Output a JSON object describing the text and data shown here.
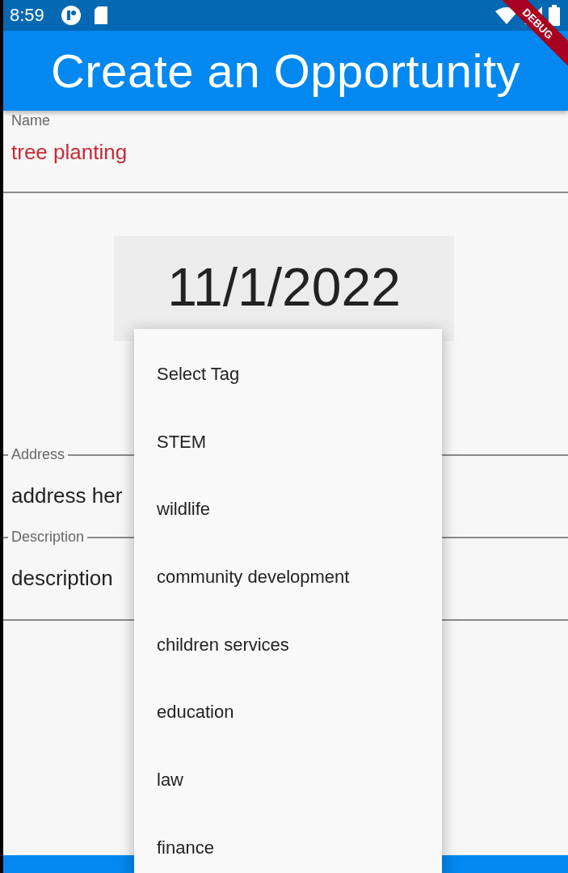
{
  "status_bar": {
    "time": "8:59"
  },
  "debug_banner": "DEBUG",
  "app_bar": {
    "title": "Create an Opportunity"
  },
  "name_field": {
    "label": "Name",
    "value": "tree planting"
  },
  "date_button": {
    "label": "11/1/2022"
  },
  "address_field": {
    "label": "Address",
    "value": "address her"
  },
  "description_field": {
    "label": "Description",
    "value": "description"
  },
  "tag_menu": {
    "items": [
      {
        "label": "Select Tag"
      },
      {
        "label": "STEM"
      },
      {
        "label": "wildlife"
      },
      {
        "label": "community development"
      },
      {
        "label": "children services"
      },
      {
        "label": "education"
      },
      {
        "label": "law"
      },
      {
        "label": "finance"
      }
    ]
  }
}
